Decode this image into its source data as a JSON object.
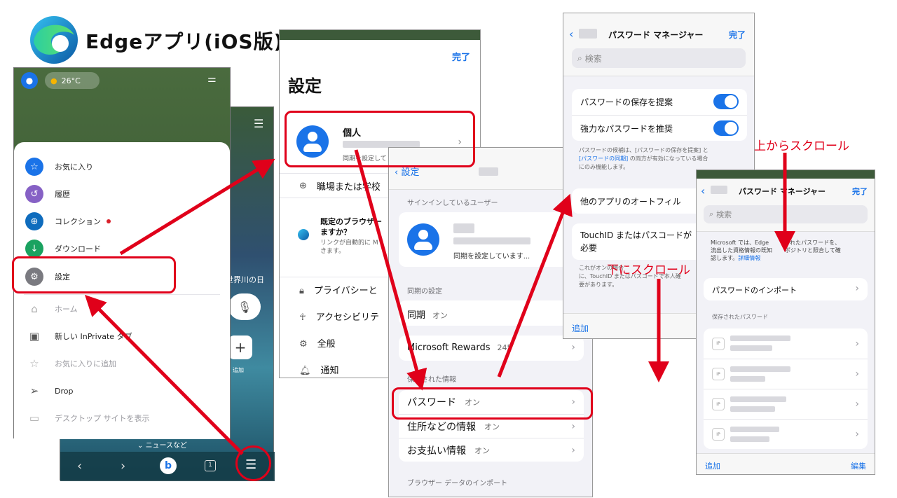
{
  "title": "Edgeアプリ(iOS版)",
  "phone": {
    "weather": "26°C",
    "date_text": "世界川の日",
    "add_label": "追加",
    "news_label": "ニュースなど",
    "tab_count": "1",
    "menu_items": [
      {
        "label": "お気に入り"
      },
      {
        "label": "履歴"
      },
      {
        "label": "コレクション"
      },
      {
        "label": "ダウンロード"
      },
      {
        "label": "設定"
      },
      {
        "label": "ホーム"
      },
      {
        "label": "新しい InPrivate タブ"
      },
      {
        "label": "お気に入りに追加"
      },
      {
        "label": "Drop"
      },
      {
        "label": "デスクトップ サイトを表示"
      }
    ]
  },
  "settings": {
    "done": "完了",
    "title": "設定",
    "profile_name": "個人",
    "profile_sub": "同期を設定して",
    "work_school": "職場または学校",
    "default_browser_title": "既定のブラウザー",
    "default_browser_title2": "ますか？",
    "default_browser_desc": "リンクが自動的に M",
    "default_browser_desc2": "きます。",
    "items": [
      "プライバシーと",
      "アクセシビリテ",
      "全般",
      "通知"
    ]
  },
  "profile": {
    "back": "設定",
    "signed_in_header": "サインインしているユーザー",
    "sync_status": "同期を設定しています...",
    "sync_header": "同期の設定",
    "sync_label": "同期",
    "sync_value": "オン",
    "rewards_label": "Microsoft Rewards",
    "rewards_value": "245",
    "saved_header": "保存された情報",
    "saved_items": [
      {
        "label": "パスワード",
        "value": "オン"
      },
      {
        "label": "住所などの情報",
        "value": "オン"
      },
      {
        "label": "お支払い情報",
        "value": "オン"
      }
    ],
    "import_header": "ブラウザー データのインポート"
  },
  "pwmgr": {
    "title": "パスワード マネージャー",
    "done": "完了",
    "search_placeholder": "検索",
    "offer_save": "パスワードの保存を提案",
    "suggest_strong": "強力なパスワードを推奨",
    "note_line1": "パスワードの候補は、[パスワードの保存を提案] と",
    "note_line2a": "[パスワードの同期]",
    "note_line2b": " の両方が有効になっている場合",
    "note_line3": "にのみ機能します。",
    "autofill": "他のアプリのオートフィル",
    "touchid": "TouchID またはパスコードが",
    "touchid2": "必要",
    "touchid_note1": "これがオンの場合",
    "touchid_note2": "に、TouchID またはパスコードで本人確",
    "touchid_note3": "要があります。",
    "add": "追加"
  },
  "pwlist": {
    "title": "パスワード マネージャー",
    "done": "完了",
    "search_placeholder": "検索",
    "info_line1a": "Microsoft では、Edge",
    "info_line1b": "されたパスワードを、",
    "info_line2a": "流出した資格情報の既知",
    "info_line2b": "ポジトリと照合して確",
    "info_line3": "認します。",
    "info_link": "詳細情報",
    "import": "パスワードのインポート",
    "saved_header": "保存されたパスワード",
    "entry_badge": "IP",
    "add": "追加",
    "edit": "編集"
  },
  "annotations": {
    "scroll_up": "上からスクロール",
    "scroll_down": "下にスクロール"
  },
  "colors": {
    "accent": "#1a73e8",
    "annotation": "#e0001a"
  }
}
